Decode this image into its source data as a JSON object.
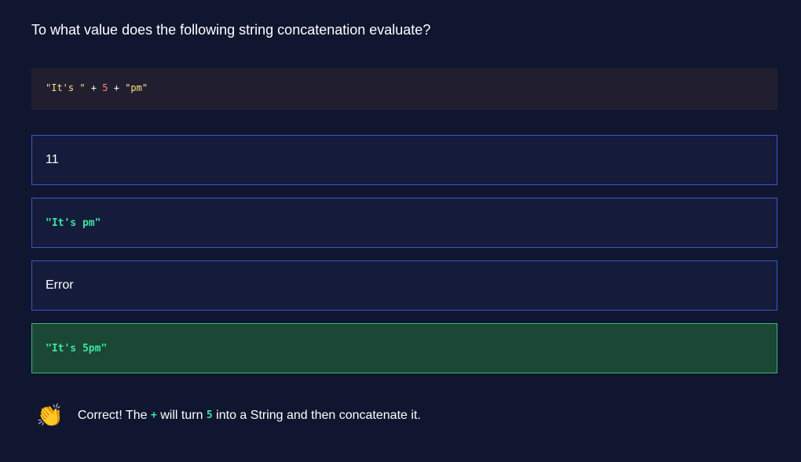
{
  "question": "To what value does the following string concatenation evaluate?",
  "code": {
    "s1": "\"It's \"",
    "op1": " + ",
    "num": "5",
    "op2": " + ",
    "s2": "\"pm\""
  },
  "options": [
    {
      "label": "11",
      "is_code": false
    },
    {
      "label": "\"It's pm\"",
      "is_code": true
    },
    {
      "label": "Error",
      "is_code": false
    },
    {
      "label": "\"It's 5pm\"",
      "is_code": true,
      "correct": true
    }
  ],
  "feedback": {
    "icon": "clapping-hands-icon",
    "t1": "Correct! The ",
    "c1": "+",
    "t2": " will turn ",
    "c2": "5",
    "t3": " into a String and then concatenate it."
  }
}
